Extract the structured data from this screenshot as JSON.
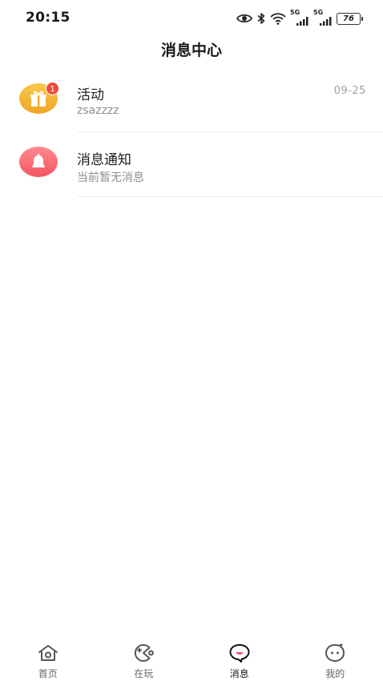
{
  "status_bar": {
    "time": "20:15",
    "icons": [
      "eye-icon",
      "bluetooth-icon",
      "wifi-icon",
      "signal-5g-icon",
      "signal-5g-icon",
      "battery-icon"
    ],
    "network_label_1": "5G",
    "network_label_2": "5G",
    "battery": "76"
  },
  "header": {
    "title": "消息中心"
  },
  "messages": [
    {
      "title": "活动",
      "subtitle": "zsazzzz",
      "time": "09-25",
      "badge": "1",
      "icon": "gift-icon",
      "color": "#f2b233"
    },
    {
      "title": "消息通知",
      "subtitle": "当前暂无消息",
      "time": "",
      "badge": "",
      "icon": "bell-icon",
      "color": "#f6646d"
    }
  ],
  "tabbar": {
    "items": [
      {
        "label": "首页",
        "icon": "home-icon"
      },
      {
        "label": "在玩",
        "icon": "gamepad-icon"
      },
      {
        "label": "消息",
        "icon": "chat-bubble-icon",
        "active": true
      },
      {
        "label": "我的",
        "icon": "profile-face-icon"
      }
    ]
  }
}
